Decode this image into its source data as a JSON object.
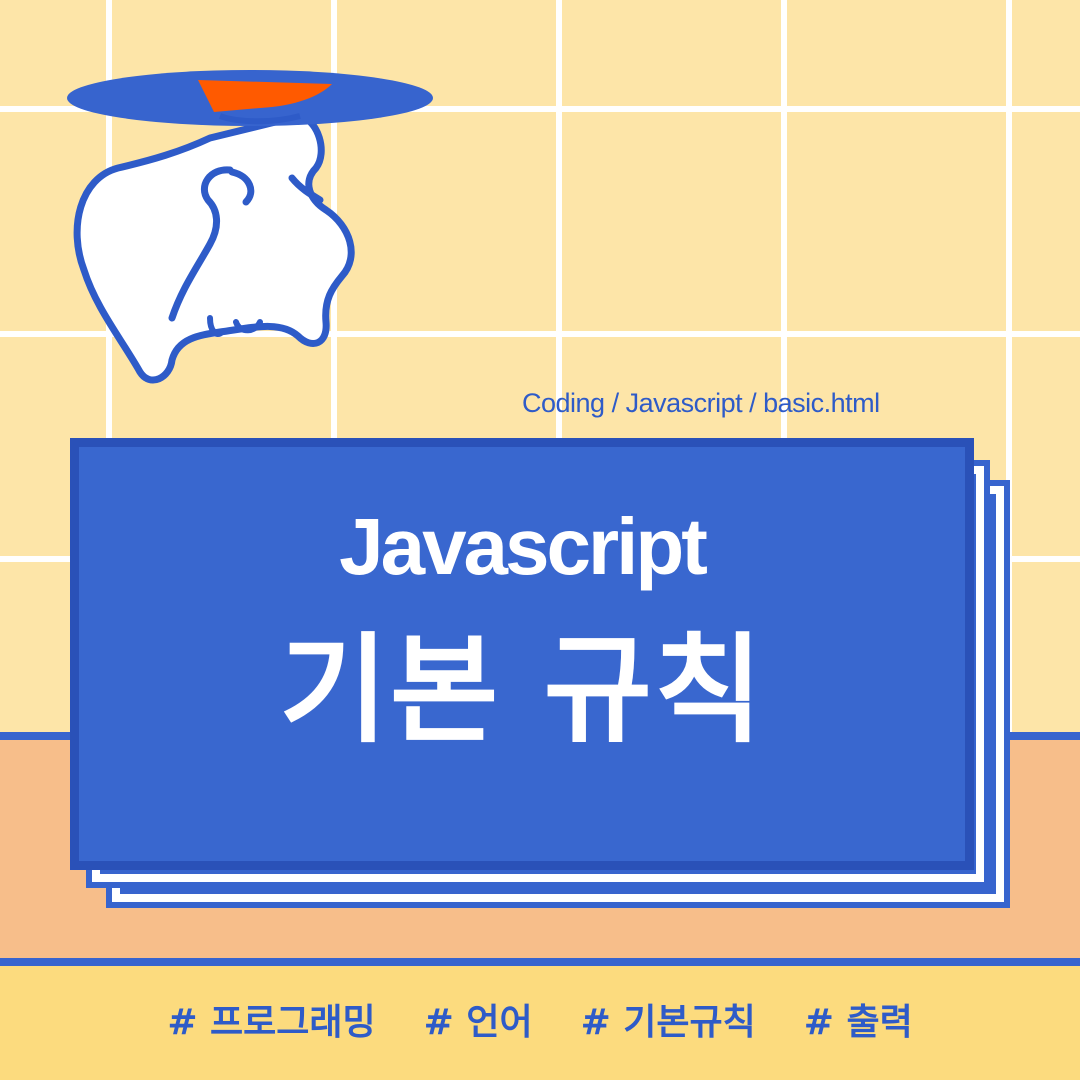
{
  "breadcrumb": "Coding / Javascript /  basic.html",
  "card": {
    "title": "Javascript",
    "subtitle": "기본 규칙"
  },
  "tags": [
    "# 프로그래밍",
    "# 언어",
    "# 기본규칙",
    "# 출력"
  ],
  "colors": {
    "grid_background": "#FDE5A8",
    "grid_lines": "#FFFFFF",
    "accent_blue": "#3764CE",
    "floor": "#F7BE8A",
    "footer": "#FCDB7E",
    "hat_band": "#FF5A00"
  },
  "icons": {
    "illustration": "ghost-with-hat-icon"
  }
}
